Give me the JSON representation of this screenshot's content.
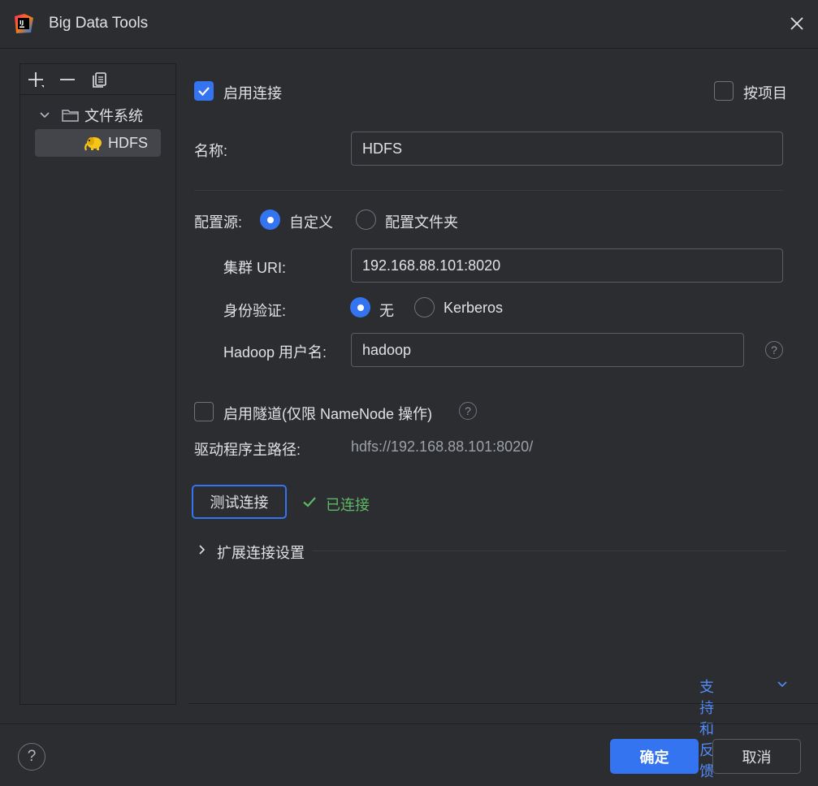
{
  "window": {
    "title": "Big Data Tools"
  },
  "tree": {
    "folder_label": "文件系统",
    "item_label": "HDFS"
  },
  "form": {
    "enable_connection_label": "启用连接",
    "per_project_label": "按项目",
    "name_label": "名称:",
    "name_value": "HDFS",
    "config_source_label": "配置源:",
    "config_source_custom": "自定义",
    "config_source_folder": "配置文件夹",
    "cluster_uri_label": "集群 URI:",
    "cluster_uri_value": "192.168.88.101:8020",
    "auth_label": "身份验证:",
    "auth_none": "无",
    "auth_kerberos": "Kerberos",
    "hadoop_user_label": "Hadoop 用户名:",
    "hadoop_user_value": "hadoop",
    "tunnel_label": "启用隧道(仅限 NameNode 操作)",
    "driver_path_label": "驱动程序主路径:",
    "driver_path_value": "hdfs://192.168.88.101:8020/",
    "test_button": "测试连接",
    "status_text": "已连接",
    "advanced_label": "扩展连接设置",
    "support_link": "支持和反馈"
  },
  "footer": {
    "ok_button": "确定",
    "cancel_button": "取消",
    "help_symbol": "?"
  },
  "colors": {
    "accent": "#3574f0",
    "success": "#5fb865",
    "link": "#548af7",
    "background": "#2b2d30"
  }
}
